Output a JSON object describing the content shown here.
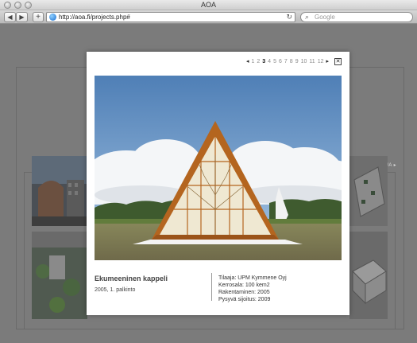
{
  "window": {
    "title": "AOA"
  },
  "toolbar": {
    "back_icon": "◀",
    "forward_icon": "▶",
    "add_icon": "+",
    "url": "http://aoa.fi/projects.php#",
    "reload_icon": "↻",
    "search_placeholder": "Google",
    "search_icon": "🔍"
  },
  "background": {
    "next_projects_label": "ÄÄ PROJEKTEJA ▸"
  },
  "modal": {
    "pager": {
      "prev_icon": "◂",
      "next_icon": "▸",
      "pages": [
        "1",
        "2",
        "3",
        "4",
        "5",
        "6",
        "7",
        "8",
        "9",
        "10",
        "11",
        "12"
      ],
      "active_page": "3",
      "close_icon": "✕"
    },
    "project": {
      "title": "Ekumeeninen kappeli",
      "subtitle": "2005, 1. palkinto",
      "details": [
        "Tilaaja: UPM Kymmene Oyj",
        "Kerrosala: 100 kem2",
        "Rakentaminen: 2005",
        "Pysyvä sijoitus: 2009"
      ]
    }
  },
  "colors": {
    "overlay": "#7b7b7b",
    "modal_bg": "#ffffff",
    "sky_top": "#5a86b8",
    "sky_bottom": "#9cc0e2",
    "frame_wood": "#b4651f"
  }
}
